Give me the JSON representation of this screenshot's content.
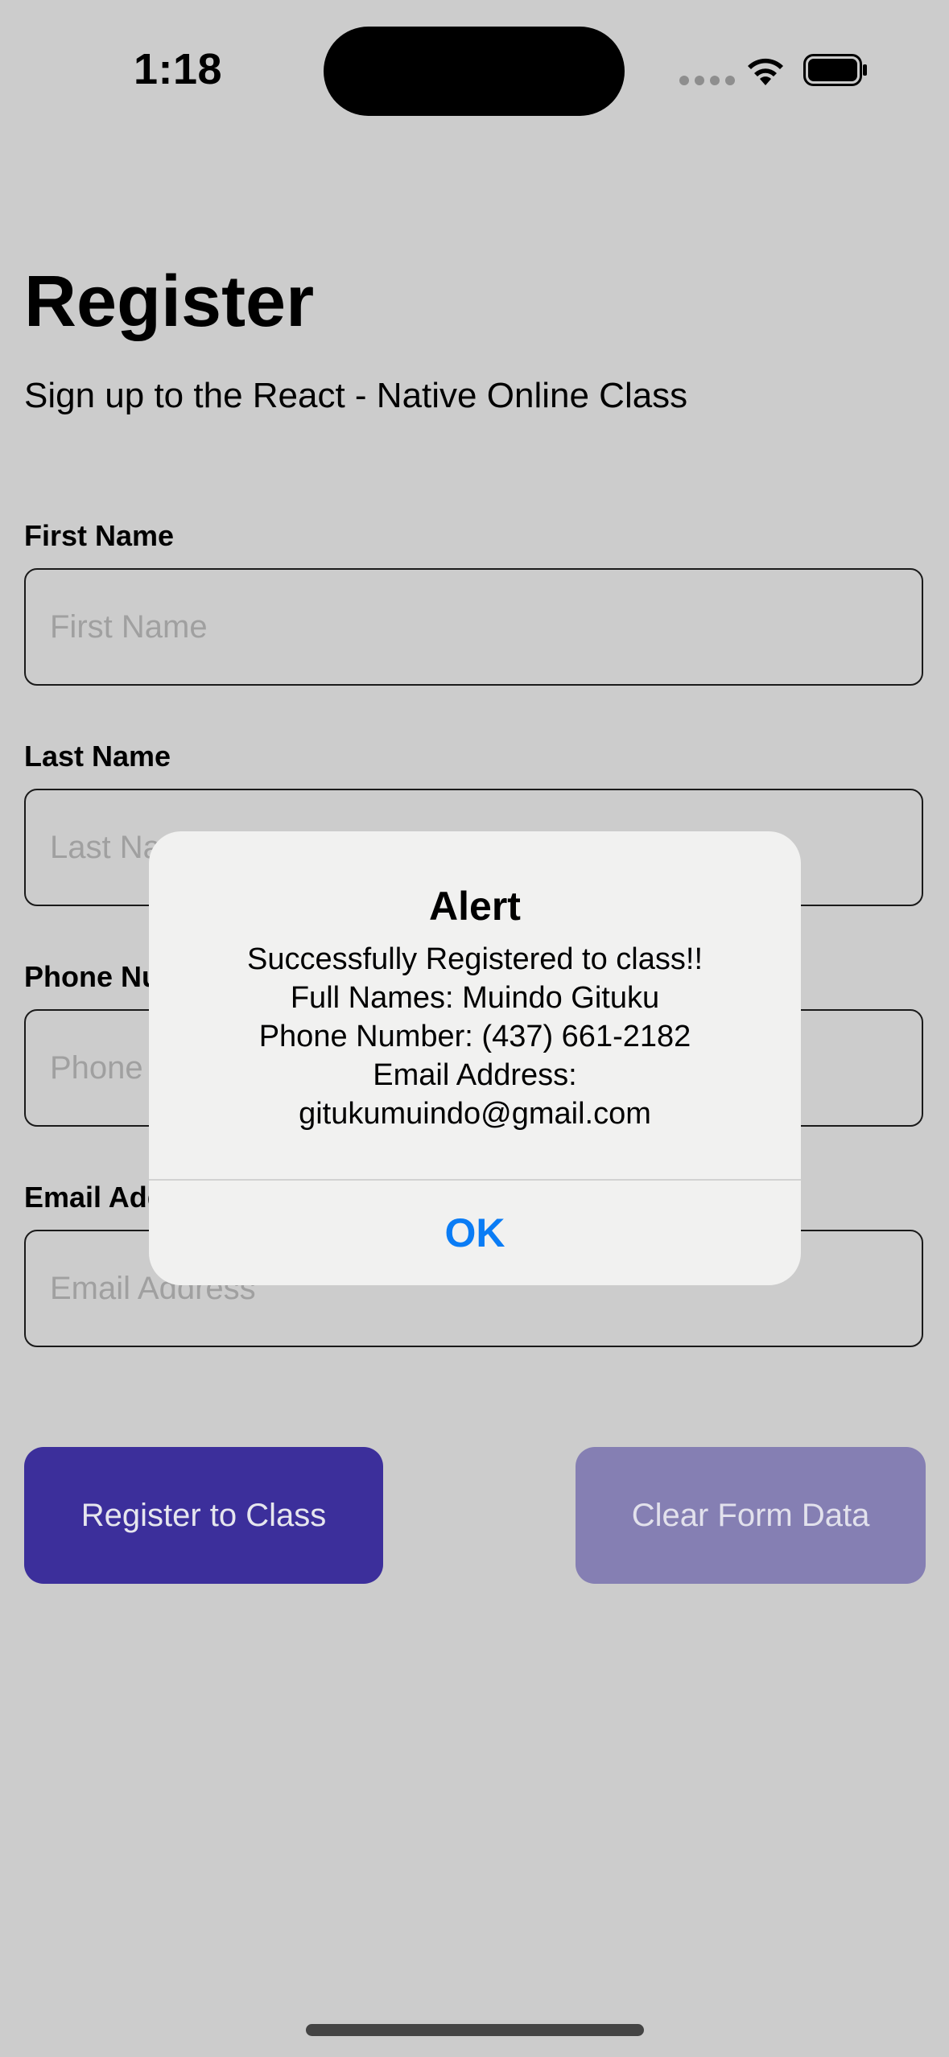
{
  "status_bar": {
    "time": "1:18",
    "wifi_icon": "wifi-icon",
    "battery_icon": "battery-icon"
  },
  "header": {
    "title": "Register",
    "subtitle": "Sign up to the React - Native Online Class"
  },
  "form": {
    "first_name": {
      "label": "First Name",
      "placeholder": "First Name",
      "value": ""
    },
    "last_name": {
      "label": "Last Name",
      "placeholder": "Last Name",
      "value": ""
    },
    "phone": {
      "label": "Phone Number",
      "placeholder": "Phone Number",
      "value": ""
    },
    "email": {
      "label": "Email Address",
      "placeholder": "Email Address",
      "value": ""
    }
  },
  "buttons": {
    "register": "Register to Class",
    "clear": "Clear Form Data"
  },
  "alert": {
    "title": "Alert",
    "lines": [
      "Successfully Registered to class!!",
      "Full Names: Muindo Gituku",
      "Phone Number: (437) 661-2182",
      "Email Address:",
      "gitukumuindo@gmail.com"
    ],
    "ok": "OK"
  },
  "colors": {
    "background": "#cccccc",
    "register_button": "#3c2f9b",
    "clear_button": "#857fb3",
    "alert_background": "#f1f1f0",
    "alert_action": "#0a7cf5"
  }
}
